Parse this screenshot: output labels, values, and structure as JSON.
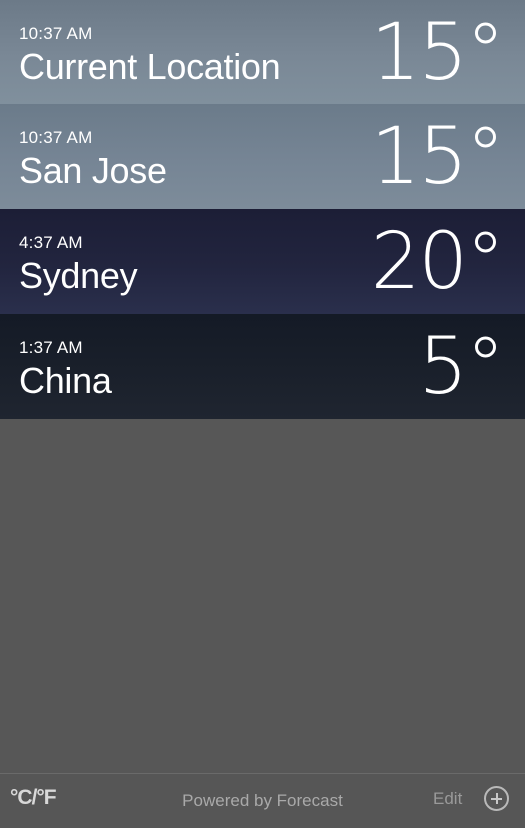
{
  "cities": [
    {
      "time": "10:37 AM",
      "name": "Current Location",
      "temp": "15°"
    },
    {
      "time": "10:37 AM",
      "name": "San Jose",
      "temp": "15°"
    },
    {
      "time": "4:37 AM",
      "name": "Sydney",
      "temp": "20°"
    },
    {
      "time": "1:37 AM",
      "name": "China",
      "temp": "5°"
    }
  ],
  "footer": {
    "unit_toggle": "°C/°F",
    "powered_by": "Powered by Forecast",
    "edit_label": "Edit",
    "add_icon": "plus-circle-icon"
  },
  "colors": {
    "background": "#575757",
    "day_row": "#7a8896",
    "night_row_sydney": "#22253f",
    "night_row_china": "#1a202b"
  }
}
